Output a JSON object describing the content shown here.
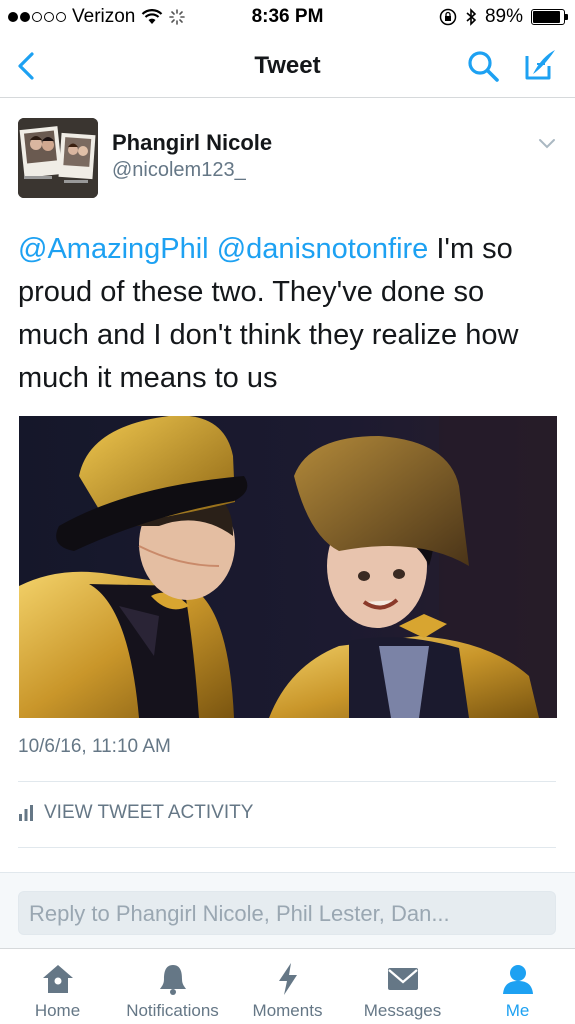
{
  "status_bar": {
    "carrier": "Verizon",
    "time": "8:36 PM",
    "battery": "89%",
    "battery_level": 0.89
  },
  "nav": {
    "title": "Tweet",
    "icons": [
      "back-chevron-icon",
      "search-icon",
      "compose-icon"
    ]
  },
  "tweet": {
    "author_name": "Phangirl Nicole",
    "author_handle": "@nicolem123_",
    "mention_1": "@AmazingPhil",
    "mention_2": "@danisnotonfire",
    "text": " I'm so proud of these two. They've done so much and I don't think they realize how much it means to us",
    "timestamp": "10/6/16, 11:10 AM",
    "activity_label": "VIEW TWEET ACTIVITY"
  },
  "reply": {
    "placeholder": "Reply to Phangirl Nicole, Phil Lester, Dan..."
  },
  "tabs": [
    {
      "label": "Home",
      "icon": "home-icon"
    },
    {
      "label": "Notifications",
      "icon": "bell-icon"
    },
    {
      "label": "Moments",
      "icon": "lightning-icon"
    },
    {
      "label": "Messages",
      "icon": "envelope-icon"
    },
    {
      "label": "Me",
      "icon": "person-icon",
      "active": true
    }
  ],
  "colors": {
    "accent": "#1da1f2",
    "secondary_text": "#657786",
    "primary_text": "#14171a"
  }
}
